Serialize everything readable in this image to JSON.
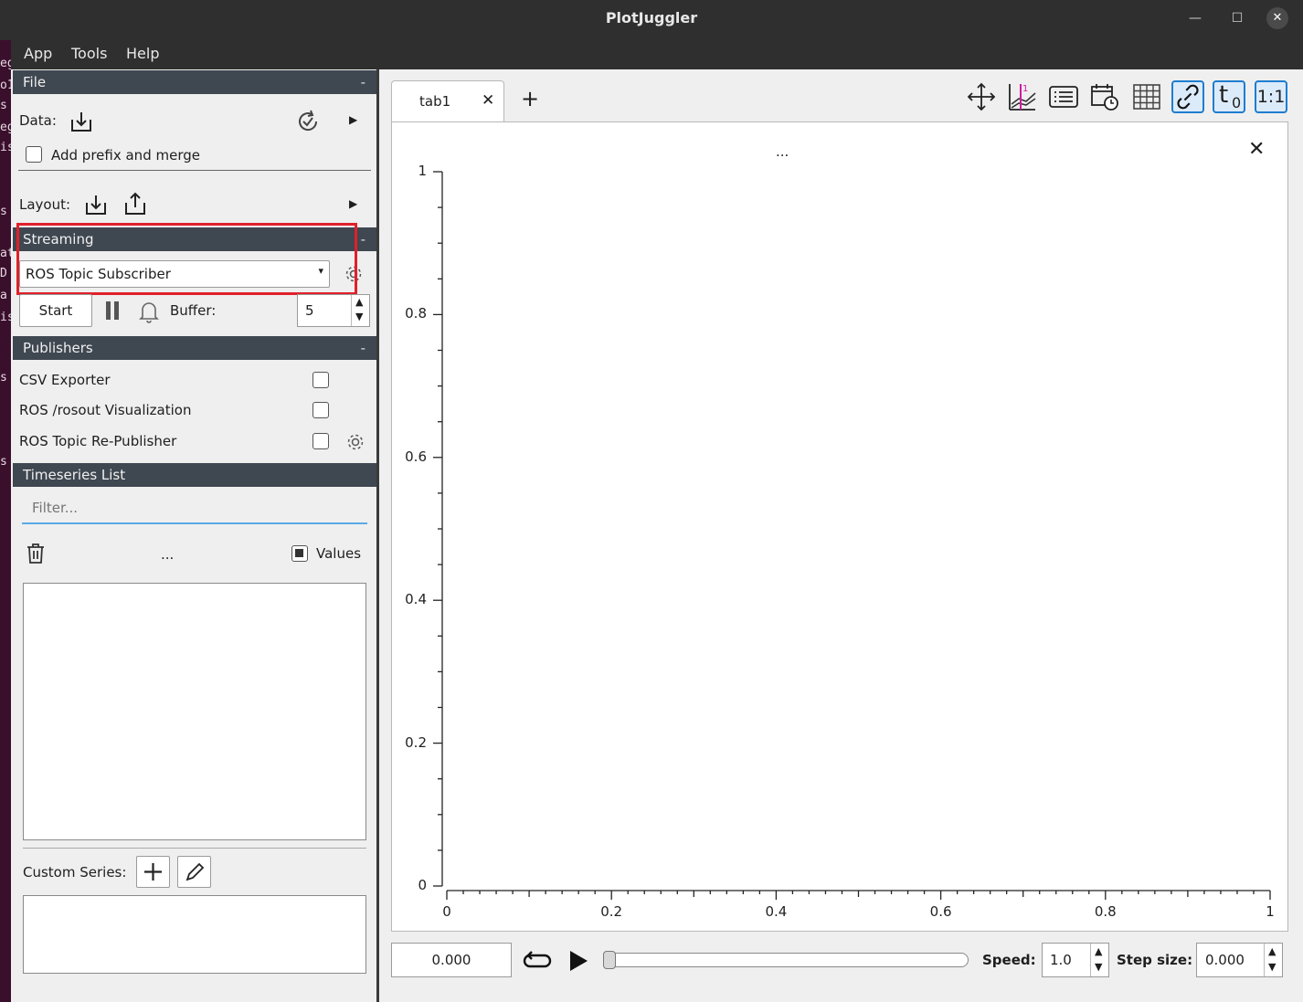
{
  "window": {
    "title": "PlotJuggler"
  },
  "menu": [
    "App",
    "Tools",
    "Help"
  ],
  "file": {
    "header": "File",
    "collapse": "-",
    "data_label": "Data:",
    "prefix_label": "Add prefix and merge",
    "layout_label": "Layout:"
  },
  "streaming": {
    "header": "Streaming",
    "collapse": "-",
    "source": "ROS Topic Subscriber",
    "start_label": "Start",
    "buffer_label": "Buffer:",
    "buffer_value": "5"
  },
  "publishers": {
    "header": "Publishers",
    "collapse": "-",
    "items": [
      "CSV Exporter",
      "ROS /rosout Visualization",
      "ROS Topic Re-Publisher"
    ]
  },
  "timeseries": {
    "header": "Timeseries List",
    "filter_placeholder": "Filter...",
    "ellipsis": "...",
    "values_label": "Values",
    "custom_label": "Custom Series:"
  },
  "tabs": [
    {
      "label": "tab1"
    }
  ],
  "add_tab": "+",
  "plot": {
    "title": "...",
    "yticks": [
      "1",
      "0.8",
      "0.6",
      "0.4",
      "0.2",
      "0"
    ],
    "xticks": [
      "0",
      "0.2",
      "0.4",
      "0.6",
      "0.8",
      "1"
    ]
  },
  "playback": {
    "time": "0.000",
    "speed_label": "Speed:",
    "speed": "1.0",
    "step_label": "Step size:",
    "step": "0.000"
  },
  "toolbar": {
    "t0_label": "t",
    "ratio_label": "1:1"
  },
  "background_text": [
    "eg",
    "o1",
    "s",
    "eg",
    "is",
    "s",
    "at",
    "D",
    "a",
    "is",
    "s",
    "s"
  ],
  "colors": {
    "section_header": "#3f4751",
    "highlight": "#e0202a",
    "accent": "#1f7dcf"
  }
}
